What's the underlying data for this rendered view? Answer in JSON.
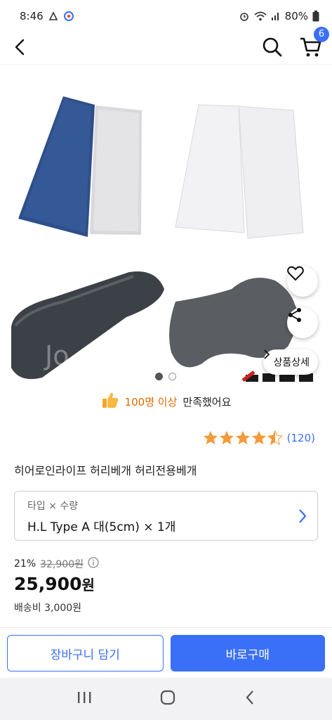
{
  "status_bar": {
    "time": "8:46",
    "battery": "80%"
  },
  "header": {
    "cart_count": "6"
  },
  "gallery": {
    "watermark": "Jo... ...on",
    "detail_button": "상품상세",
    "pager": {
      "current": 1,
      "total": 2
    }
  },
  "satisfaction": {
    "highlight": "100명 이상",
    "rest": "만족했어요"
  },
  "rating": {
    "stars": 4.5,
    "review_count": "(120)"
  },
  "product": {
    "title": "히어로인라이프 허리베개 허리전용베개"
  },
  "option": {
    "label": "타입 × 수량",
    "value": "H.L Type A 대(5cm) × 1개"
  },
  "price": {
    "discount": "21%",
    "original": "32,900원",
    "sale": "25,900",
    "sale_unit": "원",
    "shipping": "배송비 3,000원"
  },
  "actions": {
    "add_to_cart": "장바구니 담기",
    "buy_now": "바로구매"
  },
  "colors": {
    "accent": "#3a6ff7",
    "highlight": "#e06a00",
    "star": "#f39a3a"
  }
}
